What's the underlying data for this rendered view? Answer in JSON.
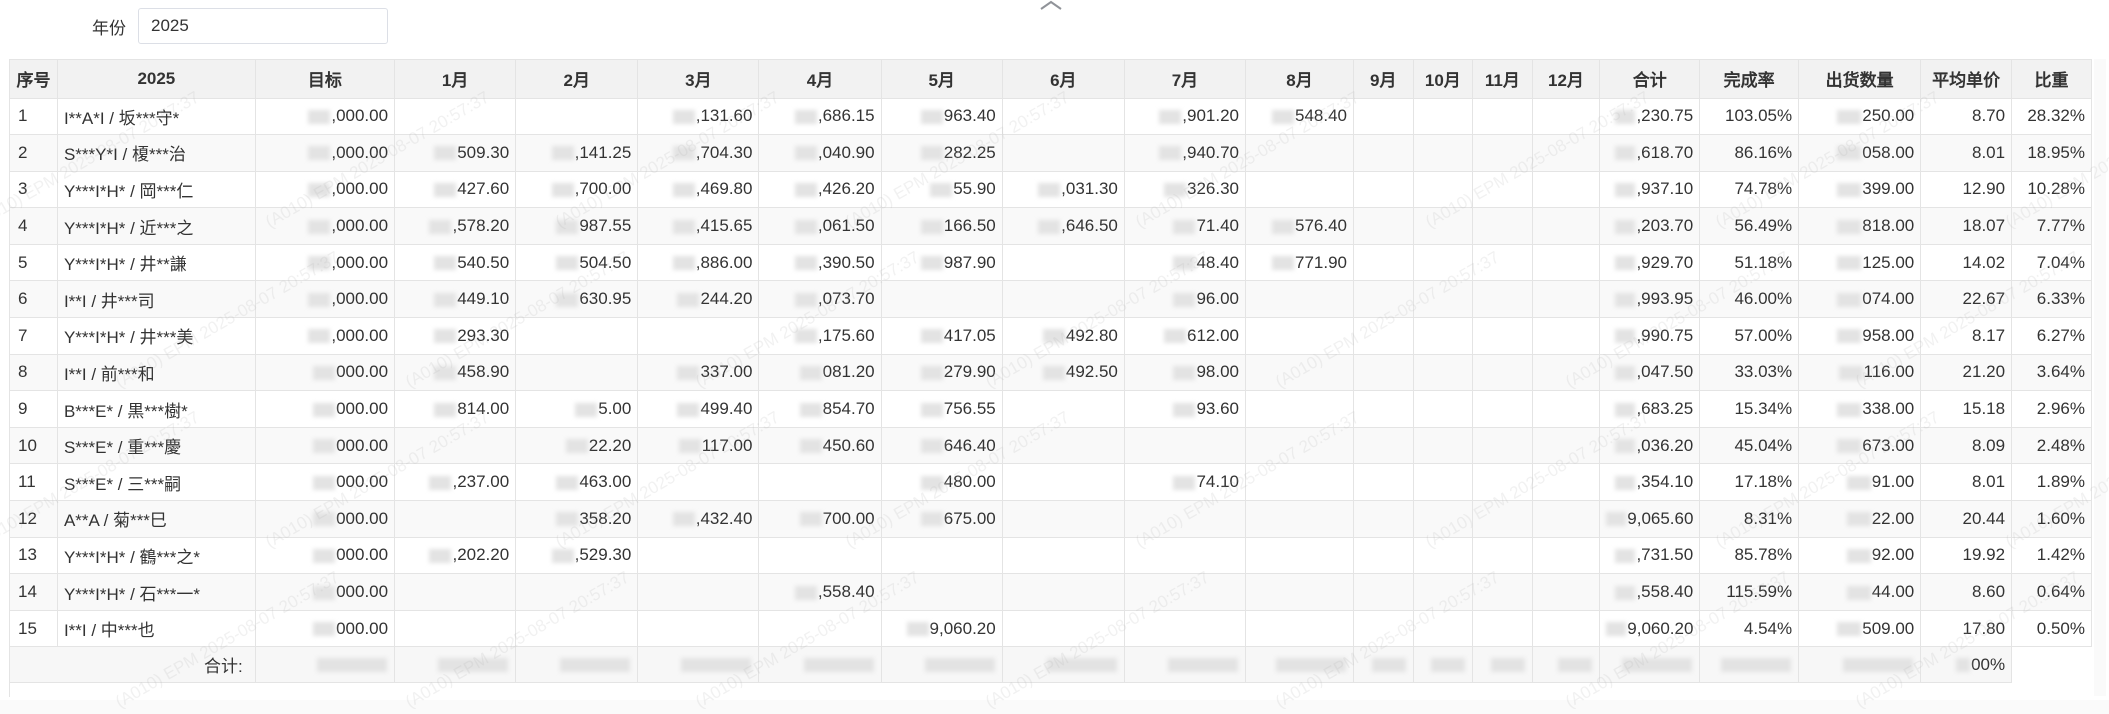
{
  "filter": {
    "year_label": "年份",
    "year_value": "2025"
  },
  "icons": {
    "collapse": "chevron-up-icon"
  },
  "watermark_text": "(A010) EPM 2025-08-07 20:57:37",
  "table": {
    "headers": [
      "序号",
      "2025",
      "目标",
      "1月",
      "2月",
      "3月",
      "4月",
      "5月",
      "6月",
      "7月",
      "8月",
      "9月",
      "10月",
      "11月",
      "12月",
      "合计",
      "完成率",
      "出货数量",
      "平均单价",
      "比重"
    ],
    "rows": [
      {
        "idx": "1",
        "name": "I**A*I / 坂***守*",
        "target": ",000.00",
        "m1": "",
        "m2": "",
        "m3": ",131.60",
        "m4": ",686.15",
        "m5": "963.40",
        "m6": "",
        "m7": ",901.20",
        "m8": "548.40",
        "total": ",230.75",
        "rate": "103.05%",
        "qty": "250.00",
        "avg": "8.70",
        "share": "28.32%"
      },
      {
        "idx": "2",
        "name": "S***Y*I / 榎***治",
        "target": ",000.00",
        "m1": "509.30",
        "m2": ",141.25",
        "m3": ",704.30",
        "m4": ",040.90",
        "m5": "282.25",
        "m6": "",
        "m7": ",940.70",
        "m8": "",
        "total": ",618.70",
        "rate": "86.16%",
        "qty": "058.00",
        "avg": "8.01",
        "share": "18.95%"
      },
      {
        "idx": "3",
        "name": "Y***I*H* / 岡***仁",
        "target": ",000.00",
        "m1": "427.60",
        "m2": ",700.00",
        "m3": ",469.80",
        "m4": ",426.20",
        "m5": "55.90",
        "m6": ",031.30",
        "m7": "326.30",
        "m8": "",
        "total": ",937.10",
        "rate": "74.78%",
        "qty": "399.00",
        "avg": "12.90",
        "share": "10.28%"
      },
      {
        "idx": "4",
        "name": "Y***I*H* / 近***之",
        "target": ",000.00",
        "m1": ",578.20",
        "m2": "987.55",
        "m3": ",415.65",
        "m4": ",061.50",
        "m5": "166.50",
        "m6": ",646.50",
        "m7": "71.40",
        "m8": "576.40",
        "total": ",203.70",
        "rate": "56.49%",
        "qty": "818.00",
        "avg": "18.07",
        "share": "7.77%"
      },
      {
        "idx": "5",
        "name": "Y***I*H* / 井**謙",
        "target": ",000.00",
        "m1": "540.50",
        "m2": "504.50",
        "m3": ",886.00",
        "m4": ",390.50",
        "m5": "987.90",
        "m6": "",
        "m7": "48.40",
        "m8": "771.90",
        "total": ",929.70",
        "rate": "51.18%",
        "qty": "125.00",
        "avg": "14.02",
        "share": "7.04%"
      },
      {
        "idx": "6",
        "name": "I**I / 井***司",
        "target": ",000.00",
        "m1": "449.10",
        "m2": "630.95",
        "m3": "244.20",
        "m4": ",073.70",
        "m5": "",
        "m6": "",
        "m7": "96.00",
        "m8": "",
        "total": ",993.95",
        "rate": "46.00%",
        "qty": "074.00",
        "avg": "22.67",
        "share": "6.33%"
      },
      {
        "idx": "7",
        "name": "Y***I*H* / 井***美",
        "target": ",000.00",
        "m1": "293.30",
        "m2": "",
        "m3": "",
        "m4": ",175.60",
        "m5": "417.05",
        "m6": "492.80",
        "m7": "612.00",
        "m8": "",
        "total": ",990.75",
        "rate": "57.00%",
        "qty": "958.00",
        "avg": "8.17",
        "share": "6.27%"
      },
      {
        "idx": "8",
        "name": "I**I / 前***和",
        "target": "000.00",
        "m1": "458.90",
        "m2": "",
        "m3": "337.00",
        "m4": "081.20",
        "m5": "279.90",
        "m6": "492.50",
        "m7": "98.00",
        "m8": "",
        "total": ",047.50",
        "rate": "33.03%",
        "qty": "116.00",
        "avg": "21.20",
        "share": "3.64%"
      },
      {
        "idx": "9",
        "name": "B***E* / 黒***樹*",
        "target": "000.00",
        "m1": "814.00",
        "m2": "5.00",
        "m3": "499.40",
        "m4": "854.70",
        "m5": "756.55",
        "m6": "",
        "m7": "93.60",
        "m8": "",
        "total": ",683.25",
        "rate": "15.34%",
        "qty": "338.00",
        "avg": "15.18",
        "share": "2.96%"
      },
      {
        "idx": "10",
        "name": "S***E* / 重***慶",
        "target": "000.00",
        "m1": "",
        "m2": "22.20",
        "m3": "117.00",
        "m4": "450.60",
        "m5": "646.40",
        "m6": "",
        "m7": "",
        "m8": "",
        "total": ",036.20",
        "rate": "45.04%",
        "qty": "673.00",
        "avg": "8.09",
        "share": "2.48%"
      },
      {
        "idx": "11",
        "name": "S***E* / 三***嗣",
        "target": "000.00",
        "m1": ",237.00",
        "m2": "463.00",
        "m3": "",
        "m4": "",
        "m5": "480.00",
        "m6": "",
        "m7": "74.10",
        "m8": "",
        "total": ",354.10",
        "rate": "17.18%",
        "qty": "91.00",
        "avg": "8.01",
        "share": "1.89%"
      },
      {
        "idx": "12",
        "name": "A**A / 菊***巳",
        "target": "000.00",
        "m1": "",
        "m2": "358.20",
        "m3": ",432.40",
        "m4": "700.00",
        "m5": "675.00",
        "m6": "",
        "m7": "",
        "m8": "",
        "total": "9,065.60",
        "rate": "8.31%",
        "qty": "22.00",
        "avg": "20.44",
        "share": "1.60%"
      },
      {
        "idx": "13",
        "name": "Y***I*H* / 鶴***之*",
        "target": "000.00",
        "m1": ",202.20",
        "m2": ",529.30",
        "m3": "",
        "m4": "",
        "m5": "",
        "m6": "",
        "m7": "",
        "m8": "",
        "total": ",731.50",
        "rate": "85.78%",
        "qty": "92.00",
        "avg": "19.92",
        "share": "1.42%"
      },
      {
        "idx": "14",
        "name": "Y***I*H* / 石***一*",
        "target": "000.00",
        "m1": "",
        "m2": "",
        "m3": "",
        "m4": ",558.40",
        "m5": "",
        "m6": "",
        "m7": "",
        "m8": "",
        "total": ",558.40",
        "rate": "115.59%",
        "qty": "44.00",
        "avg": "8.60",
        "share": "0.64%"
      },
      {
        "idx": "15",
        "name": "I**I / 中***也",
        "target": "000.00",
        "m1": "",
        "m2": "",
        "m3": "",
        "m4": "",
        "m5": "9,060.20",
        "m6": "",
        "m7": "",
        "m8": "",
        "total": "9,060.20",
        "rate": "4.54%",
        "qty": "509.00",
        "avg": "17.80",
        "share": "0.50%"
      }
    ],
    "footer": {
      "label": "合计:",
      "share": "00%"
    }
  }
}
